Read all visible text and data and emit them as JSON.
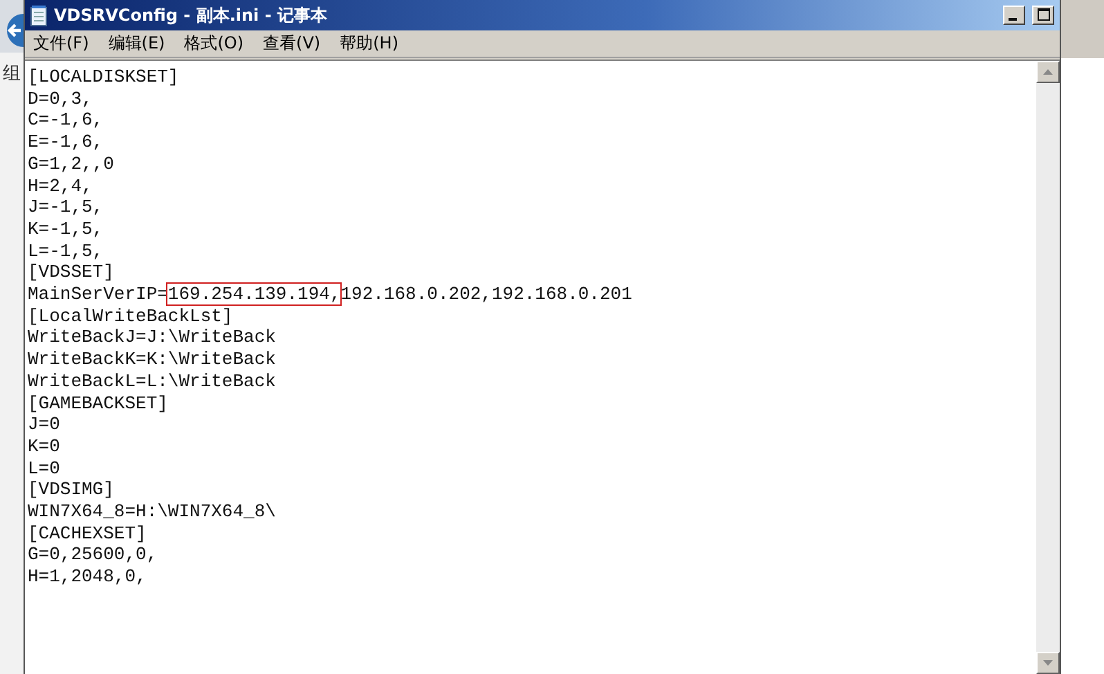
{
  "background_window": {
    "label": "组"
  },
  "window": {
    "title": "VDSRVConfig - 副本.ini - 记事本"
  },
  "menu": [
    "文件(F)",
    "编辑(E)",
    "格式(O)",
    "查看(V)",
    "帮助(H)"
  ],
  "lines": [
    {
      "segments": [
        {
          "text": "[LOCALDISKSET]",
          "highlighted": false
        }
      ]
    },
    {
      "segments": [
        {
          "text": "D=0,3,",
          "highlighted": false
        }
      ]
    },
    {
      "segments": [
        {
          "text": "C=-1,6,",
          "highlighted": false
        }
      ]
    },
    {
      "segments": [
        {
          "text": "E=-1,6,",
          "highlighted": false
        }
      ]
    },
    {
      "segments": [
        {
          "text": "G=1,2,,0",
          "highlighted": false
        }
      ]
    },
    {
      "segments": [
        {
          "text": "H=2,4,",
          "highlighted": false
        }
      ]
    },
    {
      "segments": [
        {
          "text": "J=-1,5,",
          "highlighted": false
        }
      ]
    },
    {
      "segments": [
        {
          "text": "K=-1,5,",
          "highlighted": false
        }
      ]
    },
    {
      "segments": [
        {
          "text": "L=-1,5,",
          "highlighted": false
        }
      ]
    },
    {
      "segments": [
        {
          "text": "[VDSSET]",
          "highlighted": false
        }
      ]
    },
    {
      "segments": [
        {
          "text": "MainSerVerIP=",
          "highlighted": false
        },
        {
          "text": "169.254.139.194,",
          "highlighted": true
        },
        {
          "text": "192.168.0.202,192.168.0.201",
          "highlighted": false
        }
      ]
    },
    {
      "segments": [
        {
          "text": "[LocalWriteBackLst]",
          "highlighted": false
        }
      ]
    },
    {
      "segments": [
        {
          "text": "WriteBackJ=J:\\WriteBack",
          "highlighted": false
        }
      ]
    },
    {
      "segments": [
        {
          "text": "WriteBackK=K:\\WriteBack",
          "highlighted": false
        }
      ]
    },
    {
      "segments": [
        {
          "text": "WriteBackL=L:\\WriteBack",
          "highlighted": false
        }
      ]
    },
    {
      "segments": [
        {
          "text": "[GAMEBACKSET]",
          "highlighted": false
        }
      ]
    },
    {
      "segments": [
        {
          "text": "J=0",
          "highlighted": false
        }
      ]
    },
    {
      "segments": [
        {
          "text": "K=0",
          "highlighted": false
        }
      ]
    },
    {
      "segments": [
        {
          "text": "L=0",
          "highlighted": false
        }
      ]
    },
    {
      "segments": [
        {
          "text": "[VDSIMG]",
          "highlighted": false
        }
      ]
    },
    {
      "segments": [
        {
          "text": "WIN7X64_8=H:\\WIN7X64_8\\",
          "highlighted": false
        }
      ]
    },
    {
      "segments": [
        {
          "text": "[CACHEXSET]",
          "highlighted": false
        }
      ]
    },
    {
      "segments": [
        {
          "text": "G=0,25600,0,",
          "highlighted": false
        }
      ]
    },
    {
      "segments": [
        {
          "text": "H=1,2048,0,",
          "highlighted": false
        }
      ]
    }
  ]
}
